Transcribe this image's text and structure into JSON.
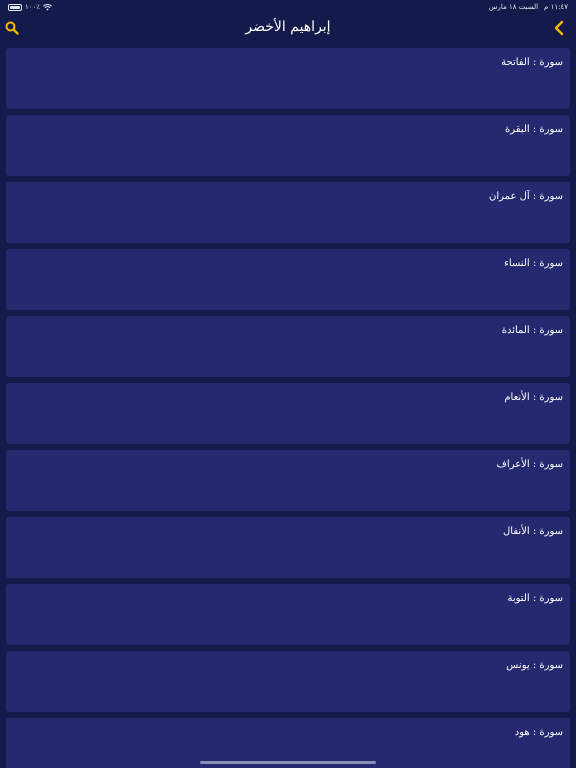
{
  "status_bar": {
    "time": "١١:٤٧ م",
    "date": "السبت ١٨ مارس",
    "battery": "١٠٠٪"
  },
  "nav": {
    "title": "إبراهيم الأخضر",
    "back_icon": "chevron-left-icon",
    "search_icon": "search-icon",
    "accent_color": "#f5b800"
  },
  "surahs": [
    {
      "label": "سورة : الفاتحة"
    },
    {
      "label": "سورة : البقرة"
    },
    {
      "label": "سورة : آل عمران"
    },
    {
      "label": "سورة : النساء"
    },
    {
      "label": "سورة : المائدة"
    },
    {
      "label": "سورة : الأنعام"
    },
    {
      "label": "سورة : الأعراف"
    },
    {
      "label": "سورة : الأنفال"
    },
    {
      "label": "سورة : التوبة"
    },
    {
      "label": "سورة : يونس"
    },
    {
      "label": "سورة : هود"
    }
  ],
  "colors": {
    "background": "#141a4a",
    "card": "#262870",
    "text": "#ffffff"
  }
}
